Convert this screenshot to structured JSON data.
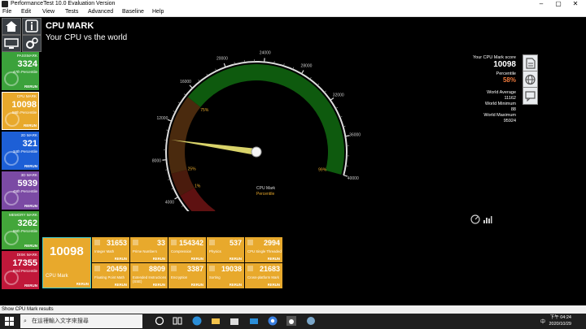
{
  "window": {
    "title": "PerformanceTest 10.0 Evaluation Version"
  },
  "menu": [
    "File",
    "Edit",
    "View",
    "Tests",
    "Advanced",
    "Baseline",
    "Help"
  ],
  "header": {
    "title": "CPU MARK",
    "subtitle": "Your CPU vs the world"
  },
  "sidebar": [
    {
      "label": "PASSMARK",
      "value": "3324",
      "percentile": "47th Percentile",
      "rerun": "RERUN",
      "color": "#3ba23b"
    },
    {
      "label": "CPU MARK",
      "value": "10098",
      "percentile": "58th Percentile",
      "rerun": "RERUN",
      "color": "#e8a92c"
    },
    {
      "label": "2D MARK",
      "value": "321",
      "percentile": "34th Percentile",
      "rerun": "RERUN",
      "color": "#1d5fd6"
    },
    {
      "label": "3D MARK",
      "value": "5939",
      "percentile": "45th Percentile",
      "rerun": "RERUN",
      "color": "#7b4aa4"
    },
    {
      "label": "MEMORY MARK",
      "value": "3262",
      "percentile": "86th Percentile",
      "rerun": "RERUN",
      "color": "#43a63a"
    },
    {
      "label": "DISK MARK",
      "value": "17355",
      "percentile": "83rd Percentile",
      "rerun": "RERUN",
      "color": "#c0183a"
    }
  ],
  "gauge": {
    "ticks": [
      "0",
      "4000",
      "8000",
      "12000",
      "16000",
      "20000",
      "24000",
      "28000",
      "32000",
      "36000",
      "40000"
    ],
    "max": 40000,
    "value": 10098,
    "zones": [
      {
        "label": "1%",
        "start": 0,
        "end": 4000,
        "color": "#5e1111"
      },
      {
        "label": "25%",
        "start": 4000,
        "end": 6500,
        "color": "#4a1b0d"
      },
      {
        "label": "75%",
        "start": 6500,
        "end": 15000,
        "color": "#4a2a0e"
      },
      {
        "label": "99%",
        "start": 15000,
        "end": 40000,
        "color": "#0e5a0e"
      }
    ],
    "center_label": "CPU Mark",
    "center_sub": "Percentile"
  },
  "results": {
    "score_label": "Your CPU Mark score",
    "score": "10098",
    "percentile_label": "Percentile",
    "percentile": "58%",
    "world_avg_label": "World Average",
    "world_avg": "11162",
    "world_min_label": "World Minimum",
    "world_min": "88",
    "world_max_label": "World Maximum",
    "world_max": "95924"
  },
  "tests": {
    "main": {
      "value": "10098",
      "name": "CPU Mark",
      "rerun": "RERUN"
    },
    "row1": [
      {
        "value": "31653",
        "name": "Integer Math",
        "rerun": "RERUN"
      },
      {
        "value": "33",
        "name": "Prime Numbers",
        "rerun": "RERUN"
      },
      {
        "value": "154342",
        "name": "Compression",
        "rerun": "RERUN"
      },
      {
        "value": "537",
        "name": "Physics",
        "rerun": "RERUN"
      },
      {
        "value": "2994",
        "name": "CPU Single Threaded",
        "rerun": "RERUN"
      }
    ],
    "row2": [
      {
        "value": "20459",
        "name": "Floating Point Math",
        "rerun": "RERUN"
      },
      {
        "value": "8809",
        "name": "Extended Instructions (SSE)",
        "rerun": "RERUN"
      },
      {
        "value": "3387",
        "name": "Encryption",
        "rerun": "RERUN"
      },
      {
        "value": "19038",
        "name": "Sorting",
        "rerun": "RERUN"
      },
      {
        "value": "21683",
        "name": "Cross-platform Mark",
        "rerun": "RERUN"
      }
    ]
  },
  "status": "Show CPU Mark results",
  "taskbar": {
    "search_placeholder": "在這裡輸入文字來搜尋",
    "time": "下午 04:24",
    "date": "2020/10/29",
    "ime": "中"
  }
}
